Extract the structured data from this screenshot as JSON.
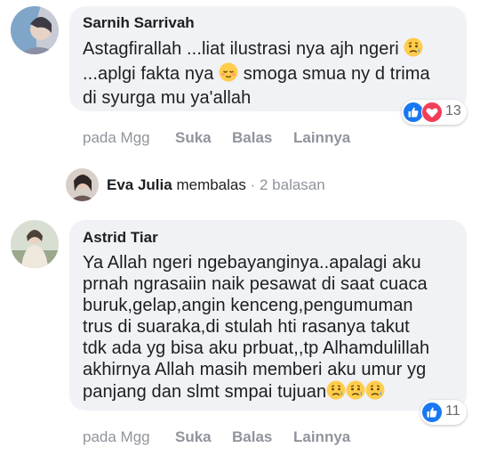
{
  "comments": [
    {
      "author": "Sarnih Sarrivah",
      "lines": [
        "Astagfirallah ...liat ilustrasi nya ajh ngeri",
        "...aplgi fakta nya",
        "smoga smua ny d trima",
        "di syurga mu ya'allah"
      ],
      "reaction_count": "13",
      "actions": {
        "time": "pada Mgg",
        "like": "Suka",
        "reply": "Balas",
        "more": "Lainnya"
      }
    },
    {
      "author": "Astrid Tiar",
      "lines": [
        "Ya Allah ngeri ngebayanginya..apalagi aku",
        "prnah ngrasaiin naik pesawat di saat cuaca",
        "buruk,gelap,angin kenceng,pengumuman",
        "trus di suaraka,di stulah hti rasanya takut",
        "tdk ada yg bisa aku prbuat,,tp Alhamdulillah",
        "akhirnya Allah masih memberi aku umur yg",
        "panjang dan slmt smpai tujuan"
      ],
      "reaction_count": "11",
      "actions": {
        "time": "pada Mgg",
        "like": "Suka",
        "reply": "Balas",
        "more": "Lainnya"
      }
    }
  ],
  "reply_summary": {
    "name": "Eva Julia",
    "verb": "membalas",
    "meta": "· 2 balasan"
  },
  "colors": {
    "bubble": "#f0f2f5",
    "like_blue": "#1877f2",
    "love_red": "#f33e58",
    "muted": "#90949c"
  }
}
